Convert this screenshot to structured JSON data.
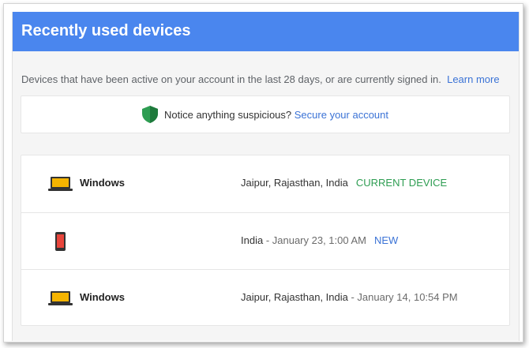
{
  "header": {
    "title": "Recently used devices"
  },
  "intro": {
    "text": "Devices that have been active on your account in the last 28 days, or are currently signed in.",
    "learn_more": "Learn more"
  },
  "notice": {
    "text": "Notice anything suspicious?",
    "link": "Secure your account"
  },
  "devices": [
    {
      "icon": "laptop-icon",
      "name": "Windows",
      "location": "Jaipur, Rajasthan, India",
      "date": "",
      "status": "CURRENT DEVICE",
      "status_color": "#2e9d52"
    },
    {
      "icon": "phone-icon",
      "name": "",
      "location": "India",
      "date": " - January 23, 1:00 AM",
      "status": "NEW",
      "status_color": "#3b73d6"
    },
    {
      "icon": "laptop-icon",
      "name": "Windows",
      "location": "Jaipur, Rajasthan, India",
      "date": " - January 14, 10:54 PM",
      "status": "",
      "status_color": ""
    }
  ],
  "colors": {
    "accent": "#4a86ee",
    "link": "#3b73d6",
    "shield": "#2e9d52",
    "laptop": "#f5b400"
  }
}
